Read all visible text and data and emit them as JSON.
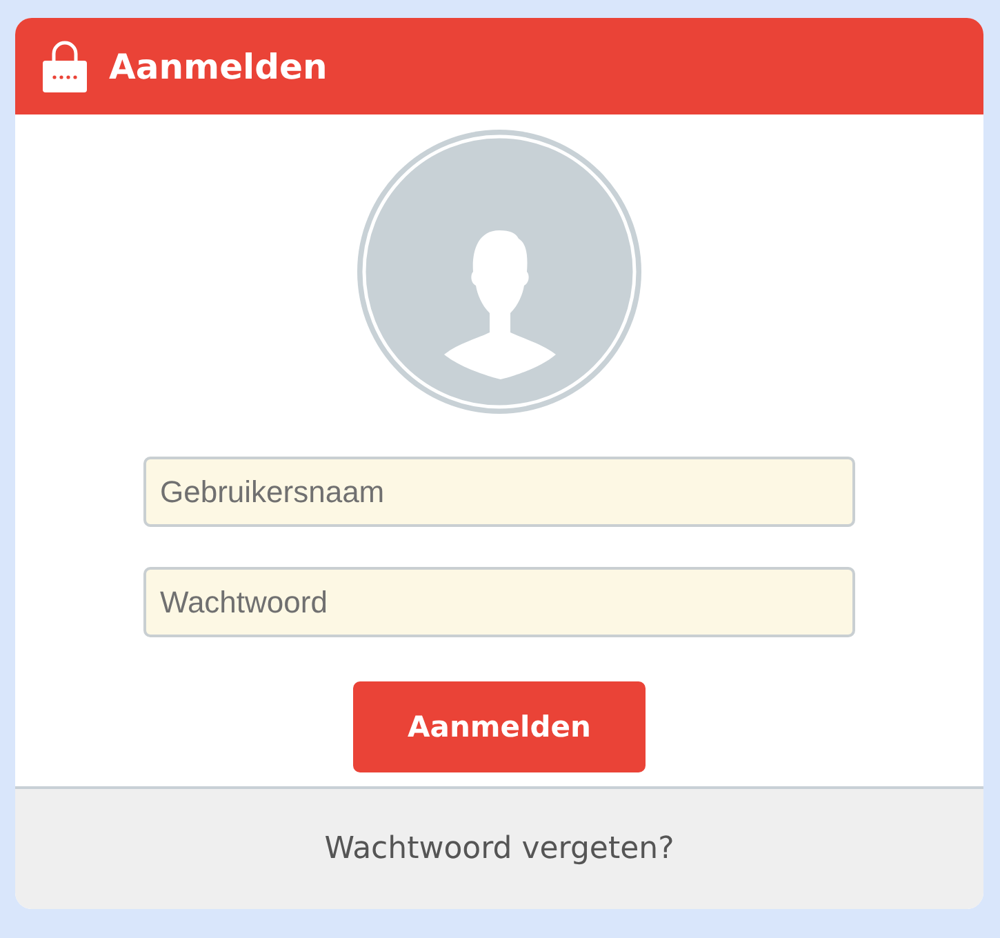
{
  "header": {
    "title": "Aanmelden"
  },
  "fields": [
    {
      "placeholder": "Gebruikersnaam"
    },
    {
      "placeholder": "Wachtwoord"
    }
  ],
  "submit_button": "Aanmelden",
  "footer": {
    "link": "Wachtwoord vergeten?"
  }
}
